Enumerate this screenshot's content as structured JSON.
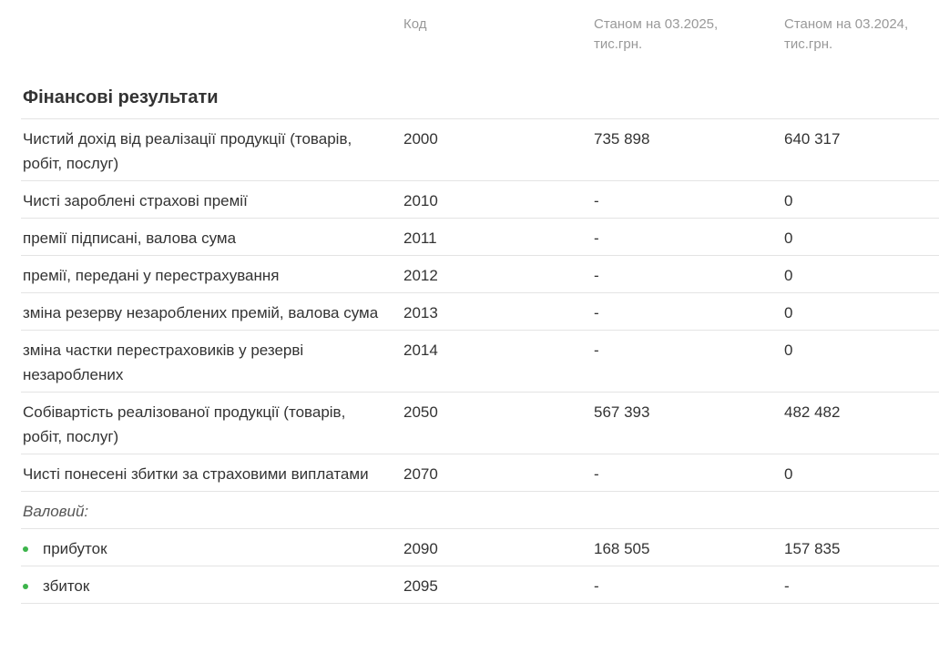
{
  "header": {
    "code": "Код",
    "current": "Станом на 03.2025, тис.грн.",
    "previous": "Станом на 03.2024, тис.грн."
  },
  "section": {
    "title": "Фінансові результати"
  },
  "rows": [
    {
      "name": "Чистий дохід від реалізації продукції (товарів, робіт, послуг)",
      "code": "2000",
      "current": "735 898",
      "previous": "640 317"
    },
    {
      "name": "Чисті зароблені страхові премії",
      "code": "2010",
      "current": "-",
      "previous": "0"
    },
    {
      "name": "премії підписані, валова сума",
      "code": "2011",
      "current": "-",
      "previous": "0"
    },
    {
      "name": "премії, передані у перестрахування",
      "code": "2012",
      "current": "-",
      "previous": "0"
    },
    {
      "name": "зміна резерву незароблених премій, валова сума",
      "code": "2013",
      "current": "-",
      "previous": "0"
    },
    {
      "name": "зміна частки перестраховиків у резерві незароблених",
      "code": "2014",
      "current": "-",
      "previous": "0"
    },
    {
      "name": "Собівартість реалізованої продукції (товарів, робіт, послуг)",
      "code": "2050",
      "current": "567 393",
      "previous": "482 482"
    },
    {
      "name": "Чисті понесені збитки за страховими виплатами",
      "code": "2070",
      "current": "-",
      "previous": "0"
    }
  ],
  "gross": {
    "label": "Валовий:",
    "items": [
      {
        "name": "прибуток",
        "code": "2090",
        "current": "168 505",
        "previous": "157 835"
      },
      {
        "name": "збиток",
        "code": "2095",
        "current": "-",
        "previous": "-"
      }
    ]
  },
  "colors": {
    "bullet": "#3cb44b",
    "border": "#e4e4e4",
    "header_text": "#999999",
    "text": "#333333"
  }
}
